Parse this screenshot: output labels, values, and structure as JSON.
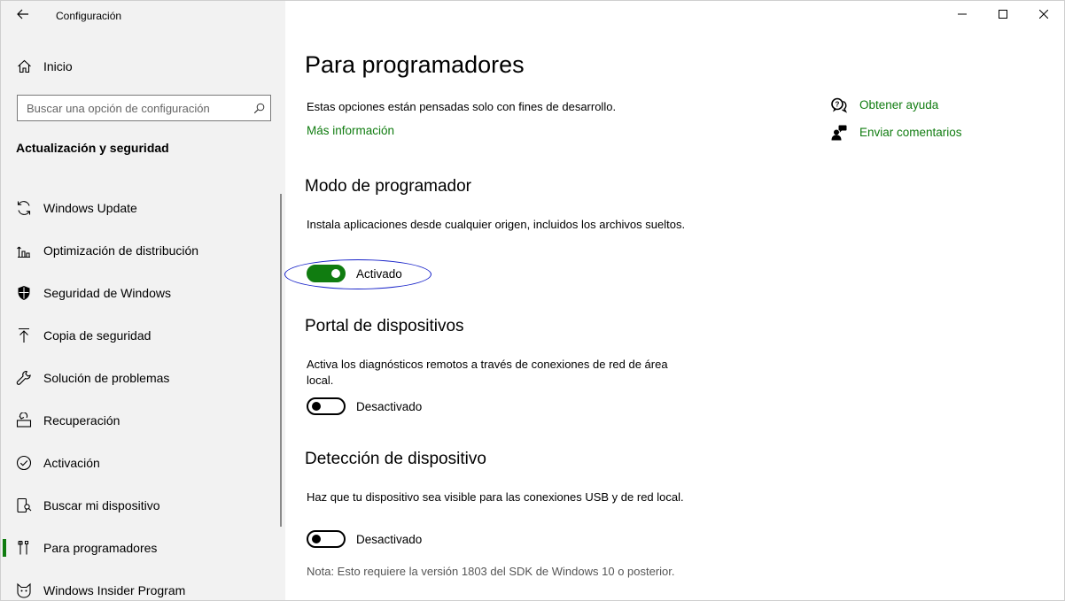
{
  "window": {
    "title": "Configuración"
  },
  "sidebar": {
    "home_label": "Inicio",
    "search": {
      "placeholder": "Buscar una opción de configuración",
      "value": ""
    },
    "section_title": "Actualización y seguridad",
    "items": [
      {
        "label": "Windows Update",
        "icon": "sync-icon"
      },
      {
        "label": "Optimización de distribución",
        "icon": "delivery-optimization-icon"
      },
      {
        "label": "Seguridad de Windows",
        "icon": "shield-icon"
      },
      {
        "label": "Copia de seguridad",
        "icon": "backup-arrow-icon"
      },
      {
        "label": "Solución de problemas",
        "icon": "wrench-icon"
      },
      {
        "label": "Recuperación",
        "icon": "recovery-icon"
      },
      {
        "label": "Activación",
        "icon": "check-circle-icon"
      },
      {
        "label": "Buscar mi dispositivo",
        "icon": "find-device-icon"
      },
      {
        "label": "Para programadores",
        "icon": "developer-tools-icon",
        "selected": true
      },
      {
        "label": "Windows Insider Program",
        "icon": "insider-cat-icon"
      }
    ]
  },
  "main": {
    "page_title": "Para programadores",
    "intro": "Estas opciones están pensadas solo con fines de desarrollo.",
    "more_info_link": "Más información",
    "developer_mode": {
      "heading": "Modo de programador",
      "description": "Instala aplicaciones desde cualquier origen, incluidos los archivos sueltos.",
      "state": "Activado",
      "on": true
    },
    "device_portal": {
      "heading": "Portal de dispositivos",
      "description": "Activa los diagnósticos remotos a través de conexiones de red de área local.",
      "state": "Desactivado",
      "on": false
    },
    "device_discovery": {
      "heading": "Detección de dispositivo",
      "description": "Haz que tu dispositivo sea visible para las conexiones USB y de red local.",
      "state": "Desactivado",
      "on": false
    },
    "note": "Nota: Esto requiere la versión 1803 del SDK de Windows 10 o posterior.",
    "help": {
      "get_help": "Obtener ayuda",
      "feedback": "Enviar comentarios"
    }
  },
  "colors": {
    "accent": "#107c10",
    "annotation": "#1520c8",
    "sidebar_bg": "#f2f2f2"
  }
}
